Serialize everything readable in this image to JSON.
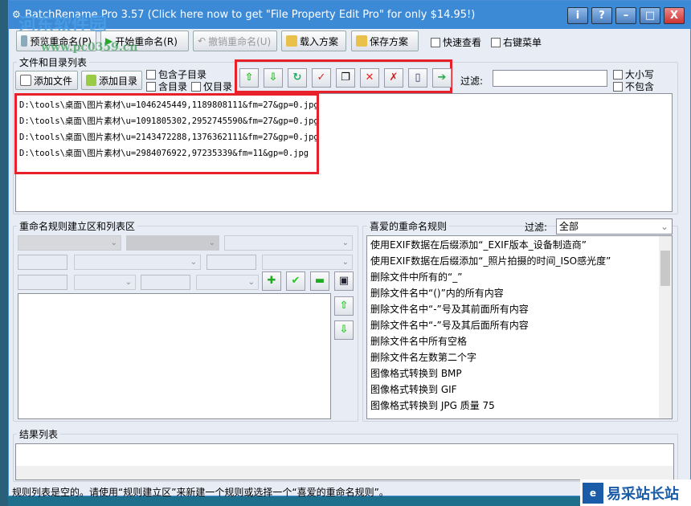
{
  "window": {
    "title": "BatchRename Pro 3.57  (Click here now to get \"File Property Edit Pro\" for only $14.95!)",
    "controls": [
      "i",
      "?",
      "–",
      "□",
      "X"
    ]
  },
  "toolbar": {
    "preview": "预览重命名(P)",
    "start": "开始重命名(R)",
    "undo": "撤销重命名(U)",
    "load": "载入方案",
    "save": "保存方案",
    "quick_view": "快速查看",
    "context_menu": "右键菜单"
  },
  "files": {
    "group_label": "文件和目录列表",
    "add_file": "添加文件",
    "add_dir": "添加目录",
    "include_subdirs": "包含子目录",
    "include_dirs": "含目录",
    "only_dirs": "仅目录",
    "filter_label": "过滤:",
    "filter_value": "",
    "case_sensitive": "大小写",
    "not_contain": "不包含",
    "icon_buttons": [
      "move-up",
      "move-down",
      "refresh",
      "check",
      "copy",
      "delete",
      "remove-invalid",
      "document",
      "export"
    ],
    "items": [
      "D:\\tools\\桌面\\图片素材\\u=1046245449,1189808111&fm=27&gp=0.jpg",
      "D:\\tools\\桌面\\图片素材\\u=1091805302,2952745590&fm=27&gp=0.jpg",
      "D:\\tools\\桌面\\图片素材\\u=2143472288,1376362111&fm=27&gp=0.jpg",
      "D:\\tools\\桌面\\图片素材\\u=2984076922,97235339&fm=11&gp=0.jpg"
    ]
  },
  "rules": {
    "group_label": "重命名规则建立区和列表区"
  },
  "favorites": {
    "group_label": "喜爱的重命名规则",
    "filter_label": "过滤:",
    "filter_value": "全部",
    "items": [
      "使用EXIF数据在后缀添加“_EXIF版本_设备制造商”",
      "使用EXIF数据在后缀添加“_照片拍摄的时间_ISO感光度”",
      "删除文件中所有的“_”",
      "删除文件名中“()”内的所有内容",
      "删除文件名中“-”号及其前面所有内容",
      "删除文件名中“-”号及其后面所有内容",
      "删除文件名中所有空格",
      "删除文件名左数第二个字",
      "图像格式转换到 BMP",
      "图像格式转换到 GIF",
      "图像格式转换到 JPG 质量 75"
    ]
  },
  "results": {
    "group_label": "结果列表"
  },
  "status": "规则列表是空的。请使用“规则建立区”来新建一个规则或选择一个“喜爱的重命名规则”。",
  "watermark": {
    "text": "易采站长站",
    "top_text": "河东软件园",
    "url_text": "www.pc0359.cn"
  },
  "colors": {
    "titlebar": "#3c8ad6",
    "highlight": "#e8202a"
  }
}
